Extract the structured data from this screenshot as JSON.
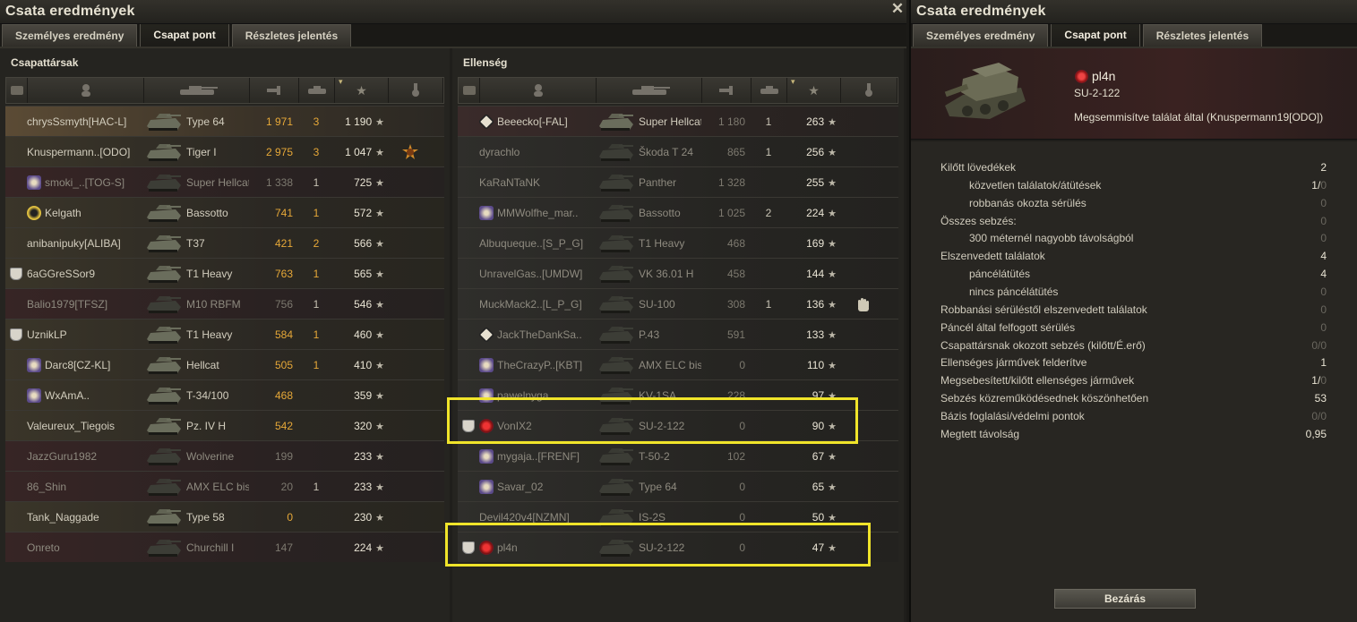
{
  "window": {
    "title": "Csata eredmények",
    "close_glyph": "✕"
  },
  "tabs": [
    {
      "label": "Személyes eredmény",
      "active": false
    },
    {
      "label": "Csapat pont",
      "active": true
    },
    {
      "label": "Részletes jelentés",
      "active": false
    }
  ],
  "team": {
    "title": "Csapattársak",
    "rows": [
      {
        "name": "chrysSsmyth[HAC-L]",
        "tank": "Type 64",
        "damage": "1 971",
        "frags": "3",
        "xp": "1 190",
        "badge": "",
        "state": "me"
      },
      {
        "name": "Knuspermann..[ODO]",
        "tank": "Tiger I",
        "damage": "2 975",
        "frags": "3",
        "xp": "1 047",
        "badge": "",
        "medal": "medal-icon",
        "state": "alive-team"
      },
      {
        "name": "smoki_..[TOG-S]",
        "tank": "Super Hellcat",
        "damage": "1 338",
        "frags": "1",
        "xp": "725",
        "badge": "clan",
        "state": "dead-team"
      },
      {
        "name": "Kelgath",
        "tank": "Bassotto",
        "damage": "741",
        "frags": "1",
        "xp": "572",
        "badge": "clan-b",
        "state": "alive-team"
      },
      {
        "name": "anibanipuky[ALIBA]",
        "tank": "T37",
        "damage": "421",
        "frags": "2",
        "xp": "566",
        "badge": "",
        "state": "alive-team"
      },
      {
        "name": "6aGGreSSor9",
        "tank": "T1 Heavy",
        "damage": "763",
        "frags": "1",
        "xp": "565",
        "badge": "shield",
        "state": "alive-team"
      },
      {
        "name": "Balio1979[TFSZ]",
        "tank": "M10 RBFM",
        "damage": "756",
        "frags": "1",
        "xp": "546",
        "badge": "",
        "state": "dead-team"
      },
      {
        "name": "UznikLP",
        "tank": "T1 Heavy",
        "damage": "584",
        "frags": "1",
        "xp": "460",
        "badge": "shield",
        "state": "alive-team"
      },
      {
        "name": "Darc8[CZ-KL]",
        "tank": "Hellcat",
        "damage": "505",
        "frags": "1",
        "xp": "410",
        "badge": "clan",
        "state": "alive-team"
      },
      {
        "name": "WxAmA..",
        "tank": "T-34/100",
        "damage": "468",
        "frags": "",
        "xp": "359",
        "badge": "clan",
        "state": "alive-team"
      },
      {
        "name": "Valeureux_Tiegois",
        "tank": "Pz. IV H",
        "damage": "542",
        "frags": "",
        "xp": "320",
        "badge": "",
        "state": "alive-team"
      },
      {
        "name": "JazzGuru1982",
        "tank": "Wolverine",
        "damage": "199",
        "frags": "",
        "xp": "233",
        "badge": "",
        "state": "dead-team"
      },
      {
        "name": "86_Shin",
        "tank": "AMX ELC bis",
        "damage": "20",
        "frags": "1",
        "xp": "233",
        "badge": "",
        "state": "dead-team"
      },
      {
        "name": "Tank_Naggade",
        "tank": "Type 58",
        "damage": "0",
        "frags": "",
        "xp": "230",
        "badge": "",
        "state": "alive-team"
      },
      {
        "name": "Onreto",
        "tank": "Churchill I",
        "damage": "147",
        "frags": "",
        "xp": "224",
        "badge": "",
        "state": "dead-team"
      }
    ]
  },
  "enemy": {
    "title": "Ellenség",
    "rows": [
      {
        "name": "Beeecko[-FAL]",
        "tank": "Super Hellcat",
        "damage": "1 180",
        "frags": "1",
        "xp": "263",
        "badge": "clan-d",
        "state": "alive-enemy"
      },
      {
        "name": "dyrachlo",
        "tank": "Škoda T 24",
        "damage": "865",
        "frags": "1",
        "xp": "256",
        "badge": "",
        "state": "dead-enemy"
      },
      {
        "name": "KaRaNTaNK",
        "tank": "Panther",
        "damage": "1 328",
        "frags": "",
        "xp": "255",
        "badge": "",
        "state": "dead-enemy"
      },
      {
        "name": "MMWolfhe_mar..",
        "tank": "Bassotto",
        "damage": "1 025",
        "frags": "2",
        "xp": "224",
        "badge": "clan",
        "state": "dead-enemy"
      },
      {
        "name": "Albuqueque..[S_P_G]",
        "tank": "T1 Heavy",
        "damage": "468",
        "frags": "",
        "xp": "169",
        "badge": "",
        "state": "dead-enemy"
      },
      {
        "name": "UnravelGas..[UMDW]",
        "tank": "VK 36.01 H",
        "damage": "458",
        "frags": "",
        "xp": "144",
        "badge": "",
        "state": "dead-enemy"
      },
      {
        "name": "MuckMack2..[L_P_G]",
        "tank": "SU-100",
        "damage": "308",
        "frags": "1",
        "xp": "136",
        "badge": "",
        "medal": "hand-icon",
        "state": "dead-enemy"
      },
      {
        "name": "JackTheDankSa..",
        "tank": "P.43",
        "damage": "591",
        "frags": "",
        "xp": "133",
        "badge": "clan-d",
        "state": "dead-enemy"
      },
      {
        "name": "TheCrazyP..[KBT]",
        "tank": "AMX ELC bis",
        "damage": "0",
        "frags": "",
        "xp": "110",
        "badge": "clan",
        "state": "dead-enemy"
      },
      {
        "name": "pawelnyga",
        "tank": "KV-1SA",
        "damage": "228",
        "frags": "",
        "xp": "97",
        "badge": "clan",
        "state": "dead-enemy"
      },
      {
        "name": "VonIX2",
        "tank": "SU-2-122",
        "damage": "0",
        "frags": "",
        "xp": "90",
        "badge": "shield+red",
        "state": "dead-enemy"
      },
      {
        "name": "mygaja..[FRENF]",
        "tank": "T-50-2",
        "damage": "102",
        "frags": "",
        "xp": "67",
        "badge": "clan",
        "state": "dead-enemy"
      },
      {
        "name": "Savar_02",
        "tank": "Type 64",
        "damage": "0",
        "frags": "",
        "xp": "65",
        "badge": "clan",
        "state": "dead-enemy"
      },
      {
        "name": "Devil420v4[NZMN]",
        "tank": "IS-2S",
        "damage": "0",
        "frags": "",
        "xp": "50",
        "badge": "",
        "state": "dead-enemy"
      },
      {
        "name": "pl4n",
        "tank": "SU-2-122",
        "damage": "0",
        "frags": "",
        "xp": "47",
        "badge": "shield+red",
        "state": "dead-enemy"
      }
    ]
  },
  "details": {
    "player": "pl4n",
    "vehicle": "SU-2-122",
    "status": "Megsemmisítve találat által (Knuspermann19[ODO])",
    "stats": [
      {
        "label": "Kilőtt lövedékek",
        "value": "2",
        "sub": false
      },
      {
        "label": "közvetlen találatok/átütések",
        "value": "1/",
        "value2": "0",
        "sub": true
      },
      {
        "label": "robbanás okozta sérülés",
        "value": "0",
        "zero": true,
        "sub": true
      },
      {
        "label": "Összes sebzés:",
        "value": "0",
        "zero": true,
        "sub": false
      },
      {
        "label": "300 méternél nagyobb távolságból",
        "value": "0",
        "zero": true,
        "sub": true
      },
      {
        "label": "Elszenvedett találatok",
        "value": "4",
        "sub": false
      },
      {
        "label": "páncélátütés",
        "value": "4",
        "sub": true
      },
      {
        "label": "nincs páncélátütés",
        "value": "0",
        "zero": true,
        "sub": true
      },
      {
        "label": "Robbanási sérüléstől elszenvedett találatok",
        "value": "0",
        "zero": true,
        "sub": false
      },
      {
        "label": "Páncél által felfogott sérülés",
        "value": "0",
        "zero": true,
        "sub": false
      },
      {
        "label": "Csapattársnak okozott sebzés (kilőtt/É.erő)",
        "value": "0/0",
        "zero": true,
        "sub": false
      },
      {
        "label": "Ellenséges járművek felderítve",
        "value": "1",
        "sub": false
      },
      {
        "label": "Megsebesített/kilőtt ellenséges járművek",
        "value": "1/",
        "value2": "0",
        "sub": false
      },
      {
        "label": "Sebzés közreműködésednek köszönhetően",
        "value": "53",
        "sub": false
      },
      {
        "label": "Bázis foglalási/védelmi pontok",
        "value": "0/0",
        "zero": true,
        "sub": false
      },
      {
        "label": "Megtett távolság",
        "value": "0,95",
        "sub": false
      }
    ],
    "close_button": "Bezárás"
  },
  "colors": {
    "highlight": "#f0e42a",
    "gold": "#e6a838"
  }
}
